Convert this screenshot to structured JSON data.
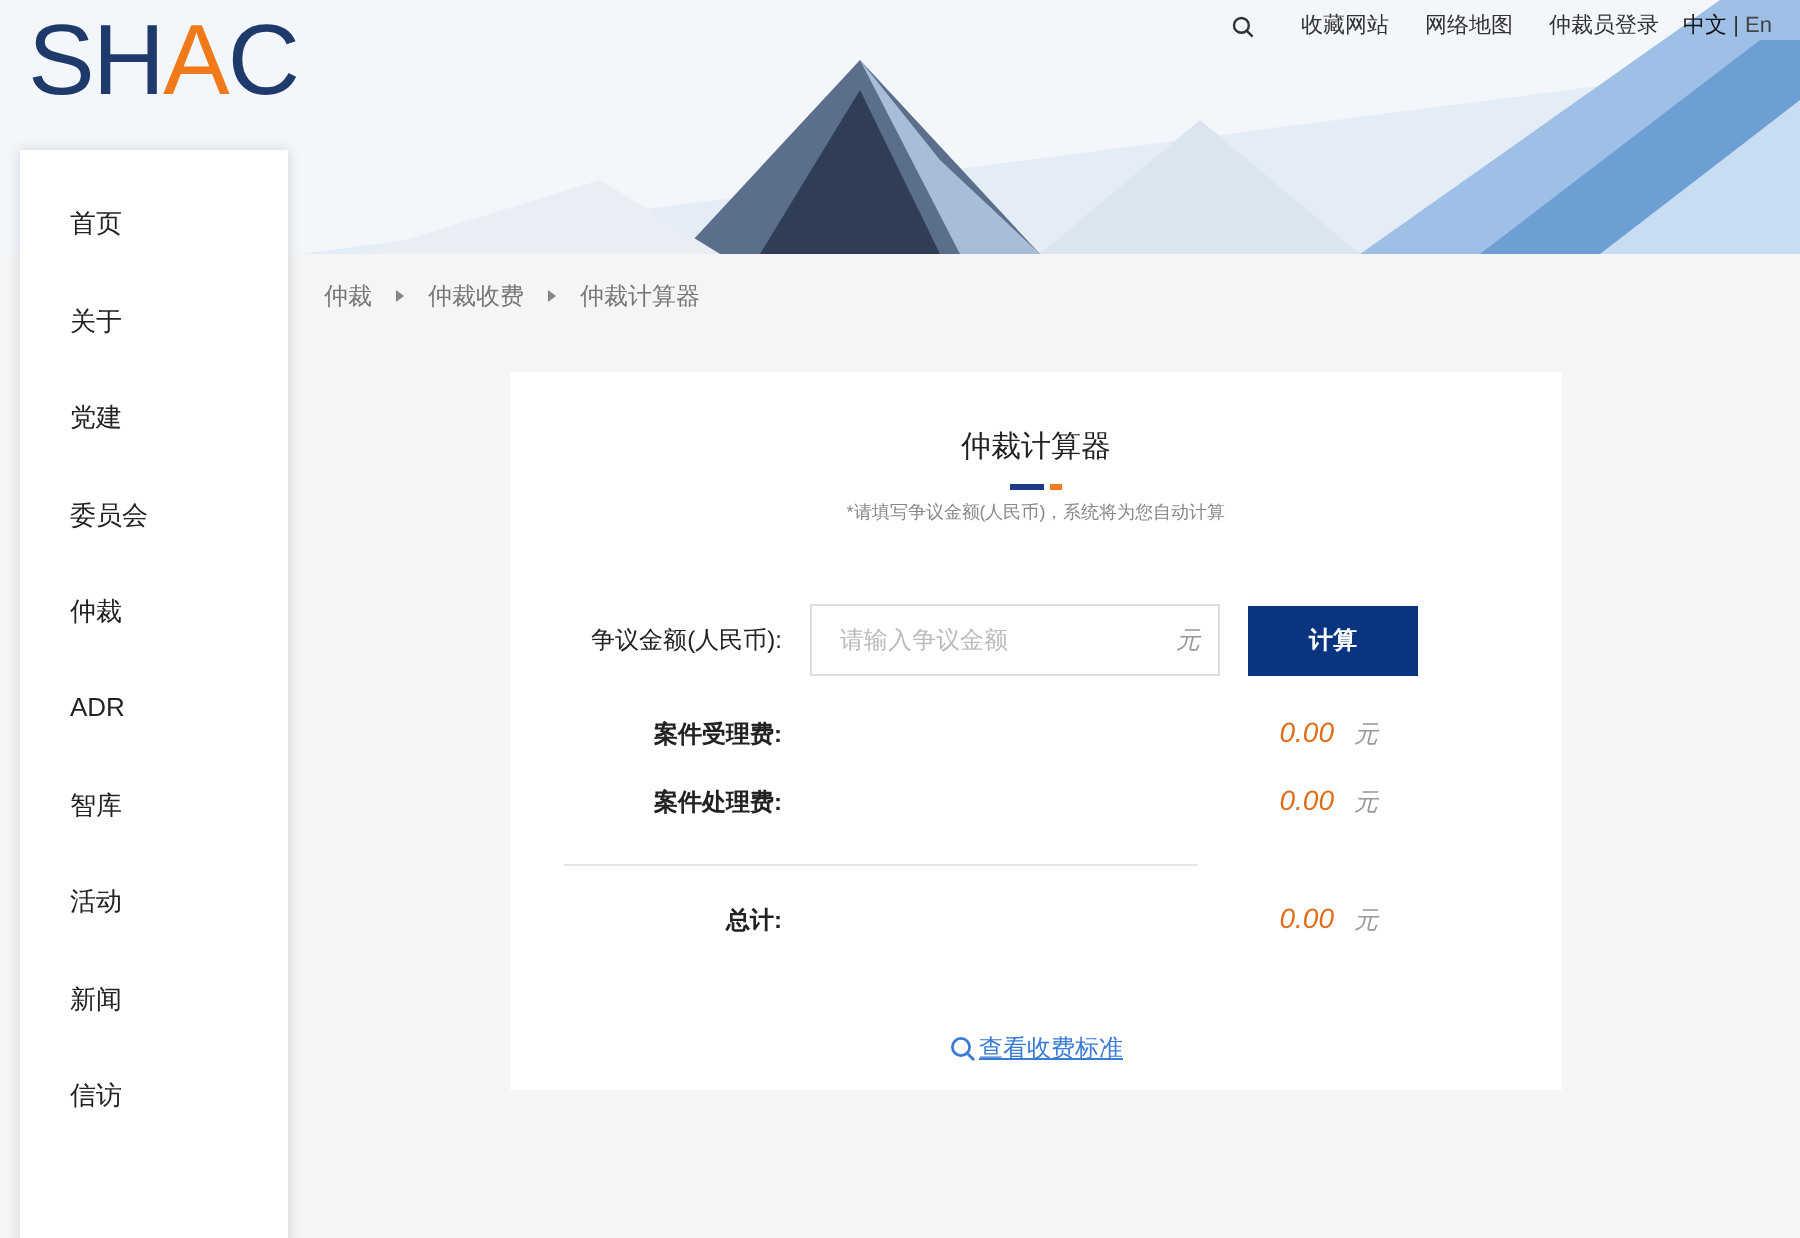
{
  "logo": {
    "letters": [
      {
        "text": "S",
        "color": "#1e3a6b"
      },
      {
        "text": "H",
        "color": "#1e3a6b"
      },
      {
        "text": "A",
        "color": "#f07a1a"
      },
      {
        "text": "C",
        "color": "#1e3a6b"
      }
    ]
  },
  "top_nav": [
    {
      "kind": "icon"
    },
    {
      "kind": "link",
      "label": "收藏网站"
    },
    {
      "kind": "link",
      "label": "网络地图"
    },
    {
      "kind": "link",
      "label": "仲裁员登录"
    },
    {
      "kind": "lang",
      "options": [
        {
          "label": "中文",
          "selected": true
        },
        {
          "label": "En",
          "selected": false
        }
      ],
      "separator": "|"
    }
  ],
  "sidebar": {
    "items": [
      {
        "label": "首页"
      },
      {
        "label": "关于"
      },
      {
        "label": "党建"
      },
      {
        "label": "委员会"
      },
      {
        "label": "仲裁"
      },
      {
        "label": "ADR"
      },
      {
        "label": "智库"
      },
      {
        "label": "活动"
      },
      {
        "label": "新闻"
      },
      {
        "label": "信访"
      }
    ]
  },
  "breadcrumb": [
    "仲裁",
    "仲裁收费",
    "仲裁计算器"
  ],
  "card": {
    "title": "仲裁计算器",
    "note": "*请填写争议金额(人民币)，系统将为您自动计算",
    "amount": {
      "label": "争议金额(人民币):",
      "placeholder": "请输入争议金额",
      "unit": "元"
    },
    "button": "计算",
    "fees": [
      {
        "label": "案件受理费:",
        "value": "0.00",
        "unit": "元"
      },
      {
        "label": "案件处理费:",
        "value": "0.00",
        "unit": "元"
      }
    ],
    "total": {
      "label": "总计:",
      "value": "0.00",
      "unit": "元"
    },
    "link": "查看收费标准"
  }
}
